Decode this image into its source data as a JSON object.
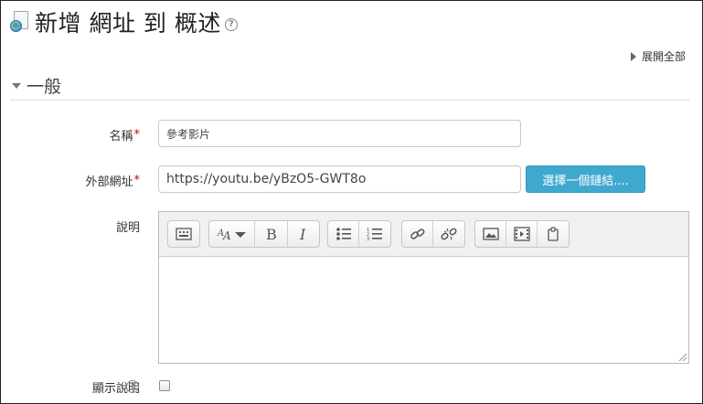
{
  "header": {
    "title": "新增 網址 到 概述",
    "title_icon": "url-resource-icon"
  },
  "expand_all_label": "展開全部",
  "section": {
    "label": "一般",
    "collapsed": false
  },
  "fields": {
    "name": {
      "label": "名稱",
      "required_mark": "*",
      "value": "參考影片"
    },
    "external_url": {
      "label": "外部網址",
      "required_mark": "*",
      "value": "https://youtu.be/yBzO5-GWT8o",
      "choose_link_button": "選擇一個鏈結...."
    },
    "description": {
      "label": "說明",
      "value": ""
    },
    "show_description": {
      "label": "顯示說明",
      "checked": false
    }
  },
  "editor_toolbar": [
    [
      "toolbar-toggle-icon"
    ],
    [
      "font-style-icon",
      "bold-icon",
      "italic-icon"
    ],
    [
      "unordered-list-icon",
      "ordered-list-icon"
    ],
    [
      "link-icon",
      "unlink-icon"
    ],
    [
      "image-icon",
      "media-icon",
      "manage-files-icon"
    ]
  ],
  "colors": {
    "accent_button": "#3fa8cf",
    "required": "#cc0000"
  }
}
